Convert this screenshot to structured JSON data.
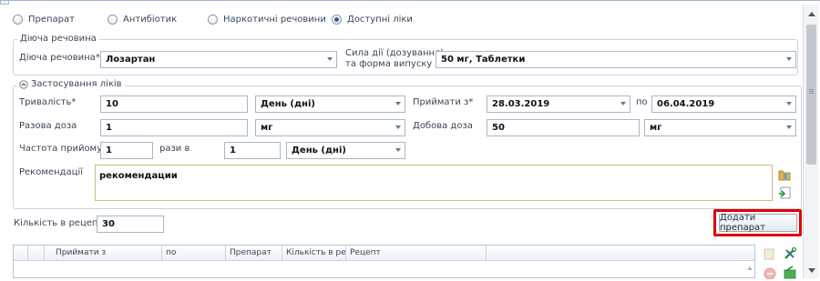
{
  "radios": [
    {
      "label": "Препарат",
      "checked": false
    },
    {
      "label": "Антибіотик",
      "checked": false
    },
    {
      "label": "Наркотичні речовини",
      "checked": false
    },
    {
      "label": "Доступні ліки",
      "checked": true
    }
  ],
  "active_ingredient": {
    "legend": "Діюча речовина",
    "label": "Діюча речовина*",
    "value": "Лозартан",
    "strength_label_line1": "Сила дії (дозування)",
    "strength_label_line2": "та форма випуску",
    "strength_value": "50 мг, Таблетки"
  },
  "usage": {
    "legend": "Застосування ліків",
    "duration_label": "Тривалість*",
    "duration_value": "10",
    "duration_unit": "День (дні)",
    "take_from_label": "Приймати з*",
    "take_from_value": "28.03.2019",
    "to_label": "по",
    "to_value": "06.04.2019",
    "single_dose_label": "Разова доза",
    "single_dose_value": "1",
    "single_dose_unit": "мг",
    "daily_dose_label": "Добова доза",
    "daily_dose_value": "50",
    "daily_dose_unit": "мг",
    "frequency_label": "Частота прийому",
    "frequency_value": "1",
    "times_in_label": "рази в",
    "period_value": "1",
    "period_unit": "День (дні)",
    "recommendations_label": "Рекомендації",
    "recommendations_value": "рекомендации"
  },
  "quantity": {
    "label": "Кількість в рецепт",
    "value": "30"
  },
  "add_button": "Додати препарат",
  "grid": {
    "columns": [
      "Приймати з",
      "по",
      "Препарат",
      "Кількість в ре",
      "Рецепт"
    ]
  },
  "colors": {
    "highlight": "#e00000",
    "border": "#a9b6c6"
  }
}
